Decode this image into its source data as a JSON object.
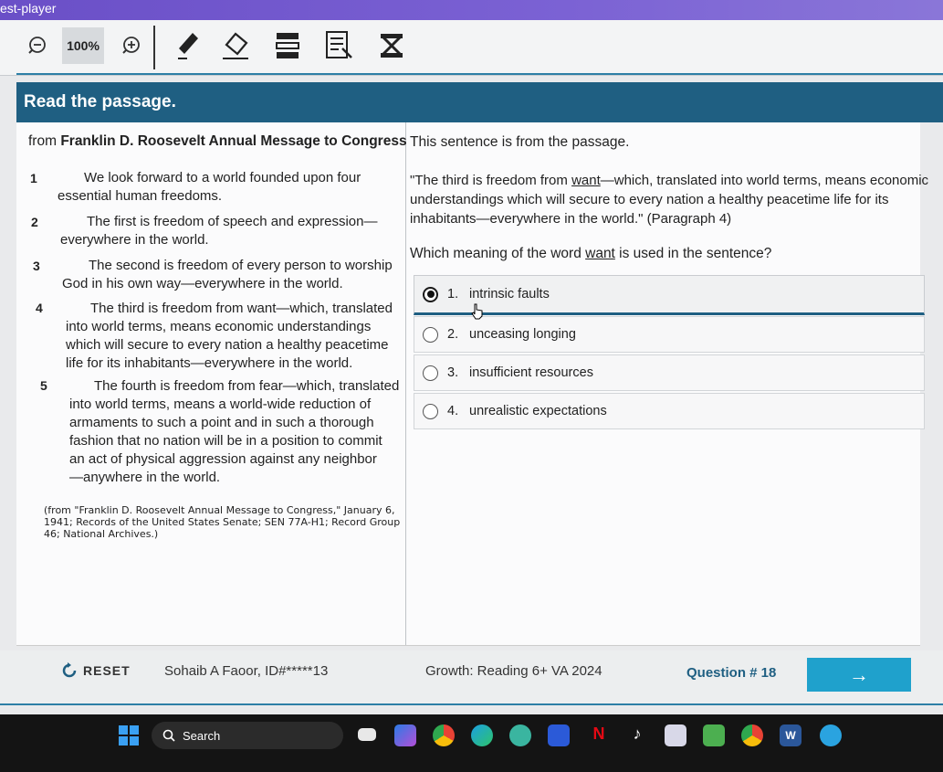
{
  "window": {
    "title": "est-player"
  },
  "toolbar": {
    "zoom_value": "100%"
  },
  "banner": {
    "title": "Read the passage."
  },
  "passage": {
    "heading_prefix": "from ",
    "heading_title": "Franklin D. Roosevelt Annual Message to Congress",
    "paragraphs": [
      {
        "num": "1",
        "first": "We look forward to a world founded upon four",
        "rest": "essential human freedoms."
      },
      {
        "num": "2",
        "first": "The first is freedom of speech and expression—",
        "rest": "everywhere in the world."
      },
      {
        "num": "3",
        "first": "The second is freedom of every person to worship",
        "rest": "God in his own way—everywhere in the world."
      },
      {
        "num": "4",
        "first": "The third is freedom from want—which, translated",
        "rest": "into world terms, means economic understandings which will secure to every nation a healthy peacetime life for its inhabitants—everywhere in the world."
      },
      {
        "num": "5",
        "first": "The fourth is freedom from fear—which, translated",
        "rest": "into world terms, means a world-wide reduction of armaments to such a point and in such a thorough fashion that no nation will be in a position to commit an act of physical aggression against any neighbor—anywhere in the world."
      }
    ],
    "citation": "(from \"Franklin D. Roosevelt Annual Message to Congress,\" January 6, 1941; Records of the United States Senate; SEN 77A-H1; Record Group 46; National Archives.)"
  },
  "question": {
    "intro": "This sentence is from the passage.",
    "quote_a": "\"The third is freedom from ",
    "quote_word": "want",
    "quote_b": "—which, translated into world terms, means economic understandings which will secure to every nation a healthy peacetime life for its inhabitants—everywhere in the world.\" (Paragraph 4)",
    "ask_a": "Which meaning of the word ",
    "ask_word": "want",
    "ask_b": " is used in the sentence?",
    "options": [
      {
        "num": "1.",
        "text": "intrinsic faults",
        "selected": true
      },
      {
        "num": "2.",
        "text": "unceasing longing",
        "selected": false
      },
      {
        "num": "3.",
        "text": "insufficient resources",
        "selected": false
      },
      {
        "num": "4.",
        "text": "unrealistic expectations",
        "selected": false
      }
    ]
  },
  "footer": {
    "reset_label": "RESET",
    "student": "Sohaib A Faoor, ID#*****13",
    "test_name": "Growth: Reading 6+ VA 2024",
    "question_number": "Question # 18",
    "next_arrow": "→"
  },
  "taskbar": {
    "search_label": "Search",
    "icons": [
      "windows-start-icon",
      "widget-icon",
      "folder-icon",
      "copilot-icon",
      "chrome-icon",
      "edge-icon",
      "chatgpt-icon",
      "app-icon",
      "netflix-icon",
      "tiktok-icon",
      "app2-icon",
      "chat-icon",
      "chrome2-icon",
      "word-icon",
      "telegram-icon"
    ]
  },
  "colors": {
    "banner": "#1f5f82",
    "next_button": "#1fa1cc",
    "title_bar": "#6a4fc7"
  }
}
